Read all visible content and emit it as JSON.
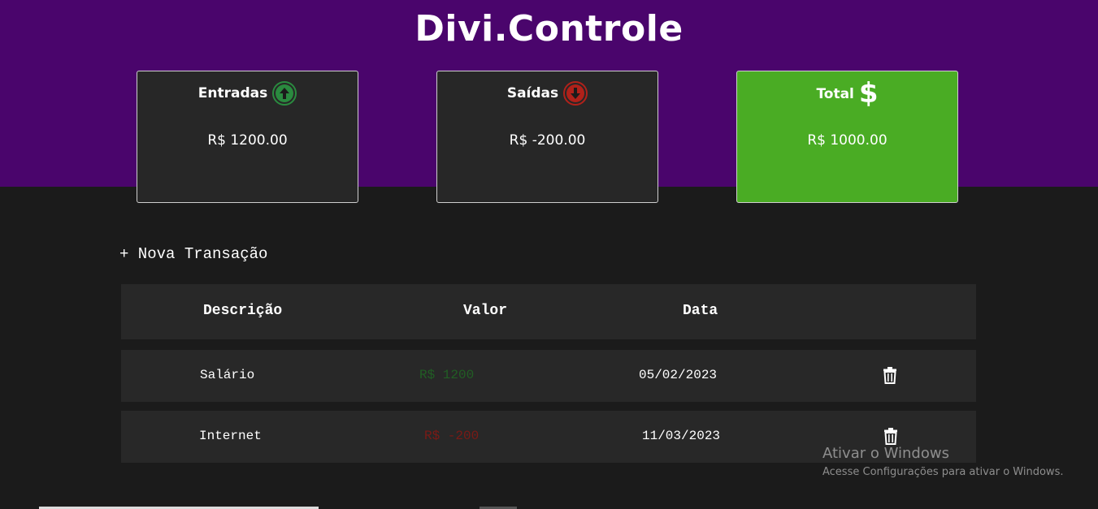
{
  "app": {
    "title": "Divi.Controle"
  },
  "cards": {
    "income": {
      "label": "Entradas",
      "value": "R$ 1200.00",
      "icon": "arrow-up-circle-icon",
      "color": "#2a8a3f"
    },
    "expense": {
      "label": "Saídas",
      "value": "R$ -200.00",
      "icon": "arrow-down-circle-icon",
      "color": "#b0211a"
    },
    "total": {
      "label": "Total",
      "value": "R$ 1000.00",
      "icon": "dollar-icon",
      "symbol": "$",
      "color": "#4aac24"
    }
  },
  "actions": {
    "new_transaction": "+ Nova Transação"
  },
  "table": {
    "headers": {
      "description": "Descrição",
      "value": "Valor",
      "date": "Data"
    },
    "rows": [
      {
        "description": "Salário",
        "value": "R$ 1200",
        "date": "05/02/2023",
        "type": "income"
      },
      {
        "description": "Internet",
        "value": "R$ -200",
        "date": "11/03/2023",
        "type": "expense"
      }
    ]
  },
  "watermark": {
    "title": "Ativar o Windows",
    "subtitle": "Acesse Configurações para ativar o Windows."
  },
  "colors": {
    "header_background": "#4a056c",
    "page_background": "#1b1b1b",
    "card_background": "#272727",
    "income_text": "#215e24",
    "expense_text": "#7a1a16"
  }
}
